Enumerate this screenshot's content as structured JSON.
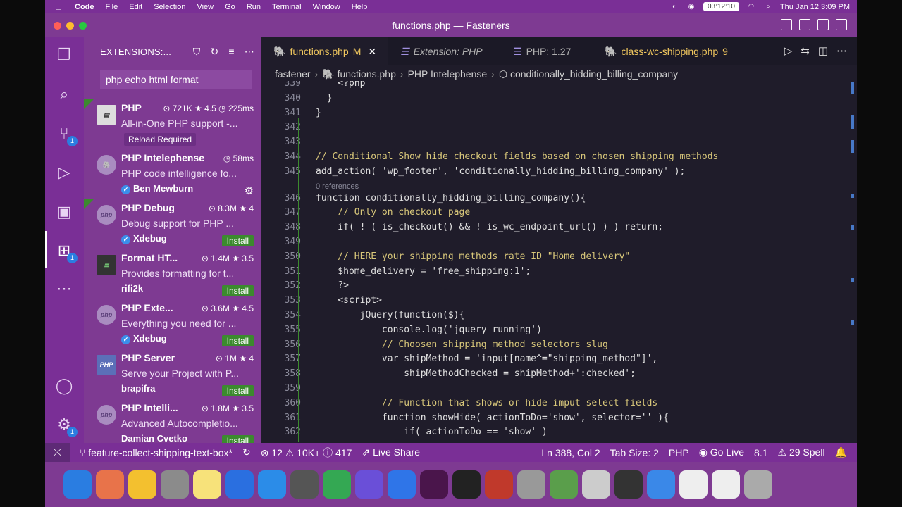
{
  "menubar": {
    "app": "Code",
    "items": [
      "File",
      "Edit",
      "Selection",
      "View",
      "Go",
      "Run",
      "Terminal",
      "Window",
      "Help"
    ],
    "timer": "03:12:10",
    "datetime": "Thu Jan 12  3:09 PM"
  },
  "window_title": "functions.php — Fasteners",
  "sidebar": {
    "header": "EXTENSIONS:...",
    "search": "php echo html format",
    "extensions": [
      {
        "name": "PHP",
        "meta": "⊙ 721K ★ 4.5 ◷ 225ms",
        "desc": "All-in-One PHP support -...",
        "action": "Reload Required",
        "logo": "php-box-icon"
      },
      {
        "name": "PHP Intelephense",
        "meta": "◷ 58ms",
        "desc": "PHP code intelligence fo...",
        "publisher": "Ben Mewburn",
        "logo": "elephant-icon"
      },
      {
        "name": "PHP Debug",
        "meta": "⊙ 8.3M ★ 4",
        "desc": "Debug support for PHP ...",
        "publisher": "Xdebug",
        "action": "Install",
        "logo": "php-icon"
      },
      {
        "name": "Format HT...",
        "meta": "⊙ 1.4M ★ 3.5",
        "desc": "Provides formatting for t...",
        "publisher": "rifi2k",
        "action": "Install",
        "logo": "code-icon"
      },
      {
        "name": "PHP Exte...",
        "meta": "⊙ 3.6M ★ 4.5",
        "desc": "Everything you need for ...",
        "publisher": "Xdebug",
        "action": "Install",
        "logo": "php-icon"
      },
      {
        "name": "PHP Server",
        "meta": "⊙ 1M ★ 4",
        "desc": "Serve your Project with P...",
        "publisher": "brapifra",
        "action": "Install",
        "logo": "php-server-icon"
      },
      {
        "name": "PHP Intelli...",
        "meta": "⊙ 1.8M ★ 3.5",
        "desc": "Advanced Autocompletio...",
        "publisher": "Damian Cvetko",
        "action": "Install",
        "logo": "php-icon"
      }
    ]
  },
  "tabs": [
    {
      "label": "functions.php",
      "modified": "M"
    },
    {
      "label": "Extension: PHP"
    },
    {
      "label": "PHP: 1.27"
    },
    {
      "label": "class-wc-shipping.php",
      "badge": "9"
    }
  ],
  "breadcrumb": [
    "fastener",
    "functions.php",
    "PHP Intelephense",
    "conditionally_hidding_billing_company"
  ],
  "code": {
    "lines": [
      {
        "n": "339",
        "t": "    <?php"
      },
      {
        "n": "340",
        "t": "  }"
      },
      {
        "n": "341",
        "t": "}"
      },
      {
        "n": "342",
        "t": ""
      },
      {
        "n": "343",
        "t": ""
      },
      {
        "n": "344",
        "t": "// Conditional Show hide checkout fields based on chosen shipping methods"
      },
      {
        "n": "345",
        "t": "add_action( 'wp_footer', 'conditionally_hidding_billing_company' );"
      },
      {
        "n": "346",
        "t": "function conditionally_hidding_billing_company(){"
      },
      {
        "n": "347",
        "t": "    // Only on checkout page"
      },
      {
        "n": "348",
        "t": "    if( ! ( is_checkout() && ! is_wc_endpoint_url() ) ) return;"
      },
      {
        "n": "349",
        "t": ""
      },
      {
        "n": "350",
        "t": "    // HERE your shipping methods rate ID \"Home delivery\""
      },
      {
        "n": "351",
        "t": "    $home_delivery = 'free_shipping:1';"
      },
      {
        "n": "352",
        "t": "    ?>"
      },
      {
        "n": "353",
        "t": "    <script>"
      },
      {
        "n": "354",
        "t": "        jQuery(function($){"
      },
      {
        "n": "355",
        "t": "            console.log('jquery running')"
      },
      {
        "n": "356",
        "t": "            // Choosen shipping method selectors slug"
      },
      {
        "n": "357",
        "t": "            var shipMethod = 'input[name^=\"shipping_method\"]',"
      },
      {
        "n": "358",
        "t": "                shipMethodChecked = shipMethod+':checked';"
      },
      {
        "n": "359",
        "t": ""
      },
      {
        "n": "360",
        "t": "            // Function that shows or hide imput select fields"
      },
      {
        "n": "361",
        "t": "            function showHide( actionToDo='show', selector='' ){"
      },
      {
        "n": "362",
        "t": "                if( actionToDo == 'show' )"
      }
    ],
    "references": "0 references"
  },
  "statusbar": {
    "branch": "feature-collect-shipping-text-box*",
    "errors": "⊗ 12 ⚠ 10K+ ⓘ 417",
    "liveshare": "Live Share",
    "position": "Ln 388, Col 2",
    "tabsize": "Tab Size: 2",
    "lang": "PHP",
    "golive": "Go Live",
    "version": "8.1",
    "spell": "⚠ 29 Spell"
  },
  "colors": {
    "accent": "#7e3a92",
    "editor_bg": "#1f1c2a",
    "install": "#3c8a2e"
  }
}
